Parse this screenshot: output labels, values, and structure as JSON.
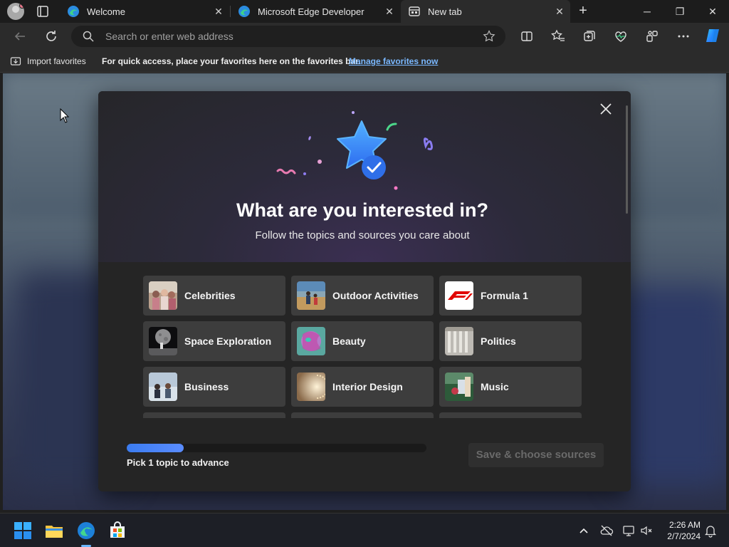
{
  "tabs": [
    {
      "title": "Welcome",
      "icon": "edge-icon"
    },
    {
      "title": "Microsoft Edge Developer",
      "icon": "edge-icon"
    },
    {
      "title": "New tab",
      "icon": "newtab-icon",
      "active": true
    }
  ],
  "address": {
    "placeholder": "Search or enter web address"
  },
  "favorites_bar": {
    "import_label": "Import favorites",
    "message": "For quick access, place your favorites here on the favorites bar.",
    "link": "Manage favorites now"
  },
  "modal": {
    "title": "What are you interested in?",
    "subtitle": "Follow the topics and sources you care about",
    "topics": [
      {
        "label": "Celebrities"
      },
      {
        "label": "Outdoor Activities"
      },
      {
        "label": "Formula 1"
      },
      {
        "label": "Space Exploration"
      },
      {
        "label": "Beauty"
      },
      {
        "label": "Politics"
      },
      {
        "label": "Business"
      },
      {
        "label": "Interior Design"
      },
      {
        "label": "Music"
      }
    ],
    "progress": {
      "fraction": 0.19,
      "label": "Pick 1 topic to advance"
    },
    "save_label": "Save & choose sources"
  },
  "taskbar": {
    "time": "2:26 AM",
    "date": "2/7/2024"
  },
  "colors": {
    "accent": "#3b7cf0",
    "link": "#7ab8ff"
  }
}
